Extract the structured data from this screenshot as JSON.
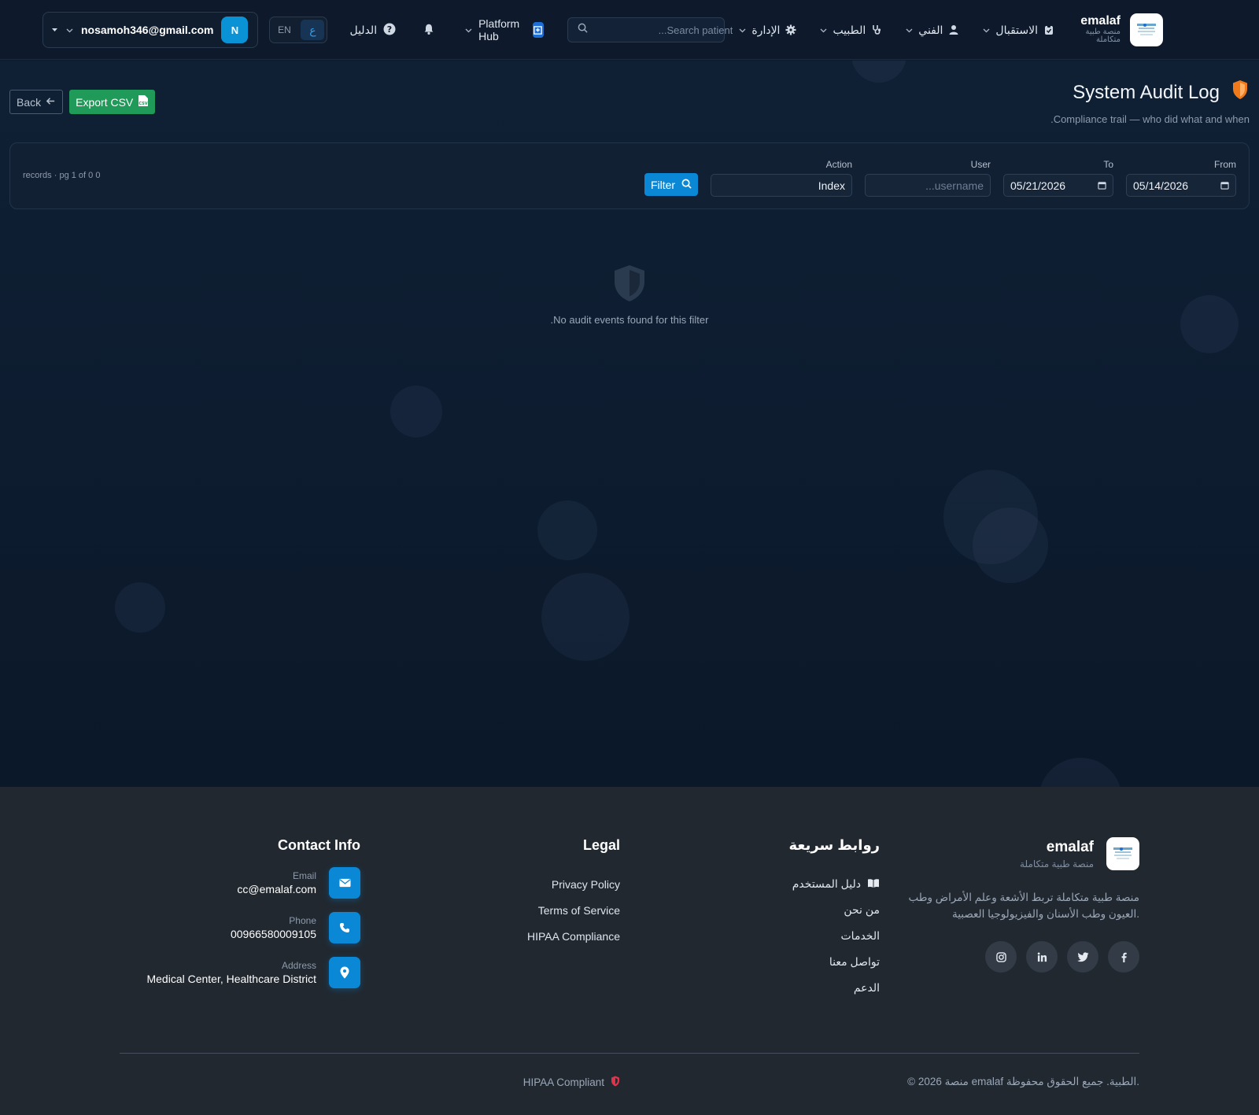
{
  "nav": {
    "brand_name": "emalaf",
    "brand_sub": "منصة طبية متكاملة",
    "menu": [
      {
        "label": "الاستقبال",
        "icon": "clipboard-icon"
      },
      {
        "label": "الفني",
        "icon": "user-tie-icon"
      },
      {
        "label": "الطبيب",
        "icon": "stethoscope-icon"
      },
      {
        "label": "الإدارة",
        "icon": "gear-icon"
      }
    ],
    "search_placeholder": "...Search patient",
    "platform_hub": "Platform Hub",
    "guide": "الدليل",
    "lang_ar": "ع",
    "lang_en": "EN",
    "user_email": "nosamoh346@gmail.com",
    "user_initial": "N"
  },
  "page": {
    "title": "System Audit Log",
    "subtitle": ".Compliance trail — who did what and when",
    "back_label": "Back",
    "export_label": "Export CSV"
  },
  "filter": {
    "records_text": "records · pg 1 of 0 0",
    "from_label": "From",
    "from_value": "05/14/2026",
    "to_label": "To",
    "to_value": "05/21/2026",
    "user_label": "User",
    "user_placeholder": "...username",
    "action_label": "Action",
    "action_value": "Index",
    "filter_button": "Filter"
  },
  "empty_state": {
    "message": ".No audit events found for this filter"
  },
  "footer": {
    "brand_name": "emalaf",
    "brand_sub": "منصة طبية متكاملة",
    "description": "منصة طبية متكاملة تربط الأشعة وعلم الأمراض وطب العيون وطب الأسنان والفيزيولوجيا العصبية.",
    "quick_links_title": "روابط سريعة",
    "quick_links": [
      "دليل المستخدم",
      "من نحن",
      "الخدمات",
      "تواصل معنا",
      "الدعم"
    ],
    "legal_title": "Legal",
    "legal_links": [
      "Privacy Policy",
      "Terms of Service",
      "HIPAA Compliance"
    ],
    "contact_title": "Contact Info",
    "email_label": "Email",
    "email_value": "cc@emalaf.com",
    "phone_label": "Phone",
    "phone_value": "00966580009105",
    "address_label": "Address",
    "address_value": "Medical Center, Healthcare District",
    "copyright": "© 2026 منصة emalaf الطبية. جميع الحقوق محفوظة.",
    "hipaa_badge": "HIPAA Compliant"
  },
  "colors": {
    "accent": "#0a88d6",
    "export_green": "#1f9a58",
    "shield_orange": "#f07a1a",
    "hipaa_red": "#e0324a"
  }
}
